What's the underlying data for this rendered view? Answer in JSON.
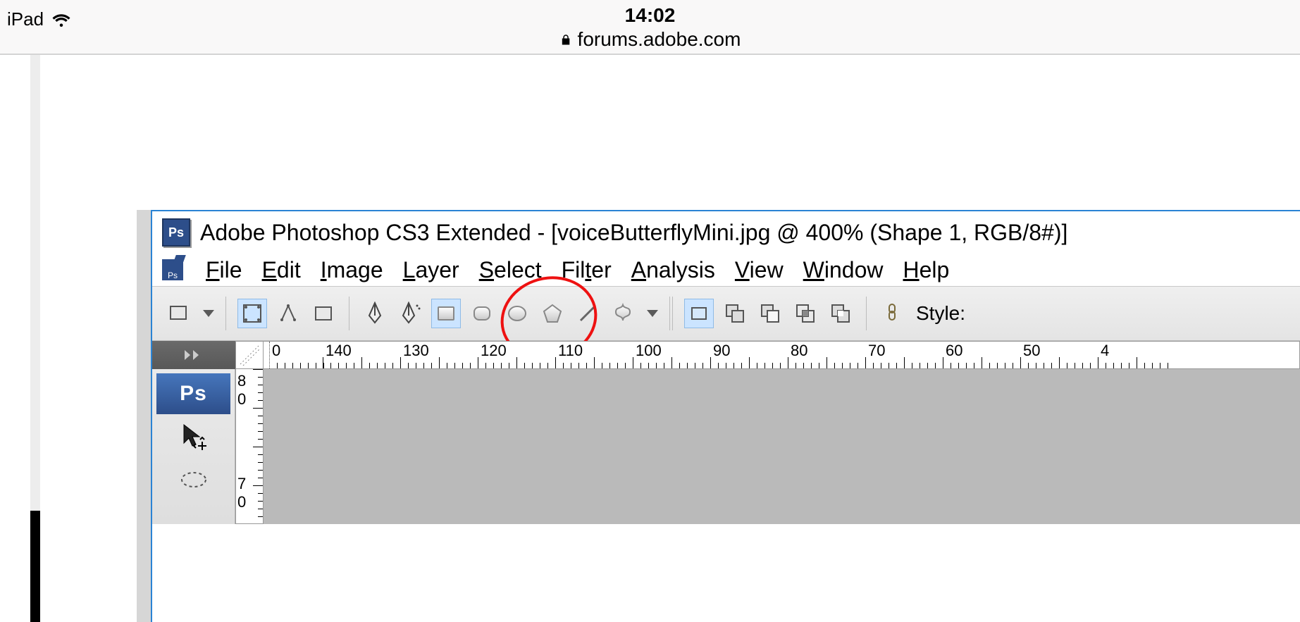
{
  "ios": {
    "device": "iPad",
    "time": "14:02",
    "url": "forums.adobe.com"
  },
  "ps": {
    "app_icon": "Ps",
    "title": "Adobe Photoshop CS3 Extended - [voiceButterflyMini.jpg @ 400% (Shape 1, RGB/8#)]",
    "menu": {
      "file": {
        "u": "F",
        "rest": "ile"
      },
      "edit": {
        "u": "E",
        "rest": "dit"
      },
      "image": {
        "u": "I",
        "rest": "mage"
      },
      "layer": {
        "u": "L",
        "rest": "ayer"
      },
      "select": {
        "u": "S",
        "rest": "elect"
      },
      "filter": {
        "pre": "Fil",
        "u": "t",
        "rest": "er"
      },
      "analysis": {
        "u": "A",
        "rest": "nalysis"
      },
      "view": {
        "u": "V",
        "rest": "iew"
      },
      "window": {
        "u": "W",
        "rest": "indow"
      },
      "help": {
        "u": "H",
        "rest": "elp"
      }
    },
    "options": {
      "style_label": "Style:"
    },
    "ruler": {
      "zero_marker": "0",
      "labels": [
        "140",
        "130",
        "120",
        "110",
        "100",
        "90",
        "80",
        "70",
        "60",
        "50",
        "4"
      ]
    },
    "vruler": {
      "labels": [
        "8",
        "0",
        "7",
        "0"
      ]
    },
    "toolpanel": {
      "header": "Ps"
    }
  }
}
